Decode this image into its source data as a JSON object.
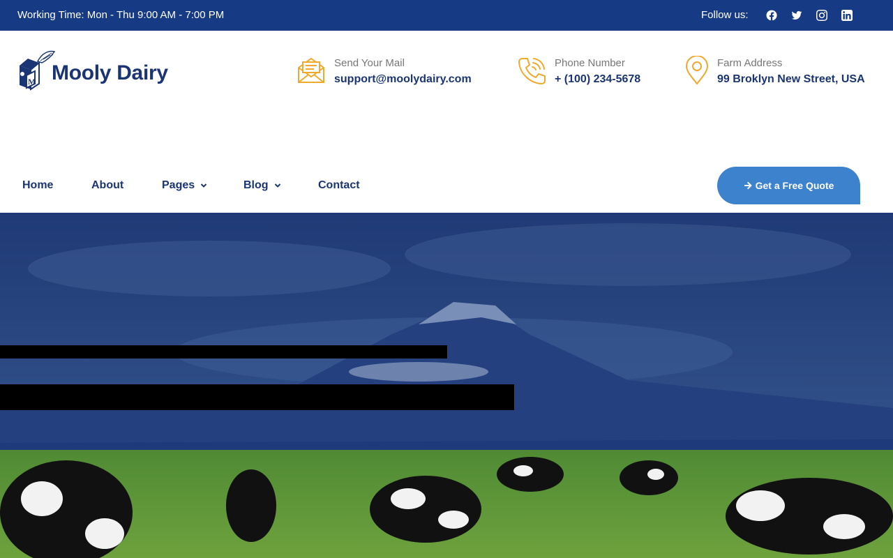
{
  "topbar": {
    "working_time": "Working Time: Mon - Thu 9:00 AM - 7:00 PM",
    "follow_label": "Follow us:",
    "social": [
      "facebook-icon",
      "twitter-icon",
      "instagram-icon",
      "linkedin-icon"
    ]
  },
  "brand": {
    "name": "Mooly Dairy",
    "logo_letter": "M"
  },
  "contact": {
    "mail": {
      "label": "Send Your Mail",
      "value": "support@moolydairy.com"
    },
    "phone": {
      "label": "Phone Number",
      "value": "+ (100) 234-5678"
    },
    "address": {
      "label": "Farm Address",
      "value": "99 Broklyn New Street, USA"
    }
  },
  "nav": {
    "items": [
      {
        "label": "Home",
        "has_dropdown": false
      },
      {
        "label": "About",
        "has_dropdown": false
      },
      {
        "label": "Pages",
        "has_dropdown": true
      },
      {
        "label": "Blog",
        "has_dropdown": true
      },
      {
        "label": "Contact",
        "has_dropdown": false
      }
    ],
    "cta_label": "Get a Free Quote"
  },
  "colors": {
    "primary": "#173a85",
    "brand_text": "#1b3474",
    "accent": "#f0a92c",
    "button": "#3d82cc"
  }
}
